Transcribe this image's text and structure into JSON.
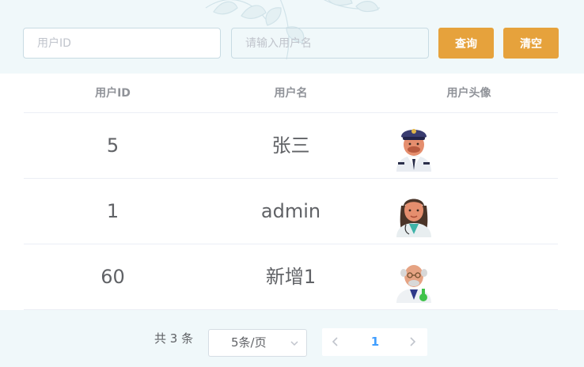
{
  "search": {
    "user_id_placeholder": "用户ID",
    "user_id_value": "",
    "username_placeholder": "请输入用户名",
    "username_value": "",
    "query_label": "查询",
    "clear_label": "清空",
    "button_color": "#e6a23c"
  },
  "table": {
    "headers": [
      "用户ID",
      "用户名",
      "用户头像"
    ],
    "rows": [
      {
        "id": "5",
        "name": "张三",
        "avatar": "pilot-avatar-icon"
      },
      {
        "id": "1",
        "name": "admin",
        "avatar": "doctor-avatar-icon"
      },
      {
        "id": "60",
        "name": "新增1",
        "avatar": "scientist-avatar-icon"
      }
    ]
  },
  "pagination": {
    "total_text": "共 3 条",
    "page_size": "5条/页",
    "current_page": "1",
    "active_color": "#409eff"
  }
}
